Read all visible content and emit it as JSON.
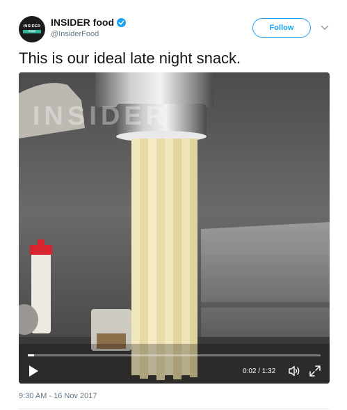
{
  "account": {
    "display_name": "INSIDER food",
    "handle": "@InsiderFood",
    "verified": true,
    "avatar": {
      "top_text": "INSIDER",
      "sub_text": "FOOD"
    }
  },
  "follow_label": "Follow",
  "tweet_text": "This is our ideal late night snack.",
  "video": {
    "watermark": "INSIDER",
    "current_time": "0:02",
    "duration": "1:32",
    "time_label": "0:02 / 1:32",
    "progress_fraction": 0.022
  },
  "timestamp": "9:30 AM - 16 Nov 2017",
  "colors": {
    "accent": "#1da1f2",
    "text": "#14171a",
    "muted": "#657786",
    "avatar_band": "#2fb59a"
  },
  "icons": {
    "verified": "verified-badge-icon",
    "caret": "chevron-down-icon",
    "play": "play-icon",
    "volume": "volume-icon",
    "fullscreen": "fullscreen-icon"
  }
}
